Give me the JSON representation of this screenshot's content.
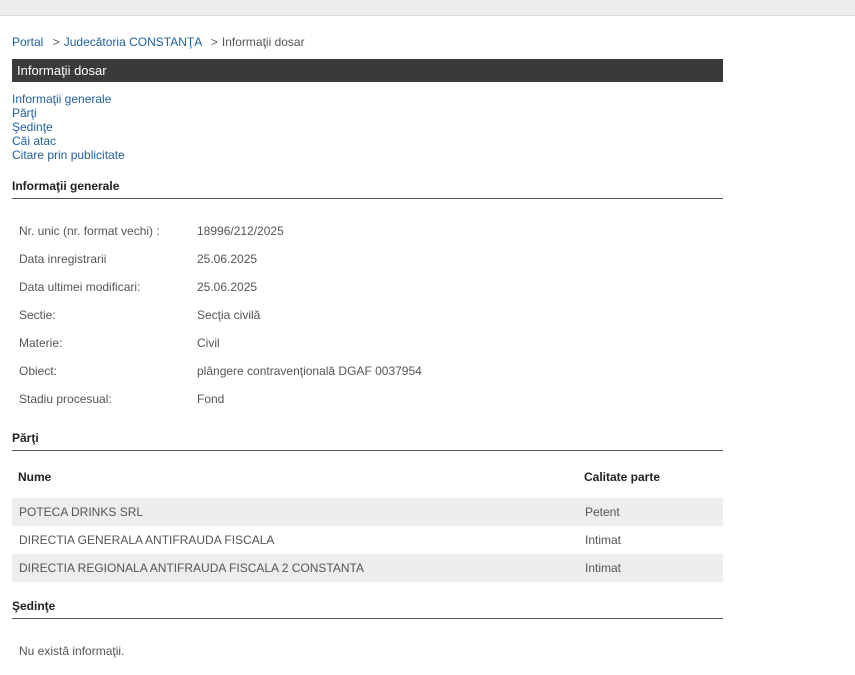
{
  "breadcrumb": {
    "portal": "Portal",
    "court": "Judecătoria CONSTANŢA",
    "current": "Informaţii dosar",
    "separator": ">"
  },
  "page_title": "Informaţii dosar",
  "anchor_links": [
    "Informaţii generale",
    "Părţi",
    "Şedinţe",
    "Căi atac",
    "Citare prin publicitate"
  ],
  "sections": {
    "general": "Informaţii generale",
    "parti": "Părţi",
    "sedinte": "Şedinţe"
  },
  "general_info": [
    {
      "label": "Nr. unic (nr. format vechi) :",
      "value": "18996/212/2025"
    },
    {
      "label": "Data inregistrarii",
      "value": "25.06.2025"
    },
    {
      "label": "Data ultimei modificari:",
      "value": "25.06.2025"
    },
    {
      "label": "Sectie:",
      "value": "Secţia civilă"
    },
    {
      "label": "Materie:",
      "value": "Civil"
    },
    {
      "label": "Obiect:",
      "value": "plângere contravenţională DGAF 0037954"
    },
    {
      "label": "Stadiu procesual:",
      "value": "Fond"
    }
  ],
  "parti_table": {
    "headers": {
      "name": "Nume",
      "role": "Calitate parte"
    },
    "rows": [
      {
        "name": "POTECA DRINKS SRL",
        "role": "Petent"
      },
      {
        "name": "DIRECTIA GENERALA ANTIFRAUDA FISCALA",
        "role": "Intimat"
      },
      {
        "name": "DIRECTIA REGIONALA ANTIFRAUDA FISCALA 2 CONSTANTA",
        "role": "Intimat"
      }
    ]
  },
  "sedinte_message": "Nu există informaţii."
}
